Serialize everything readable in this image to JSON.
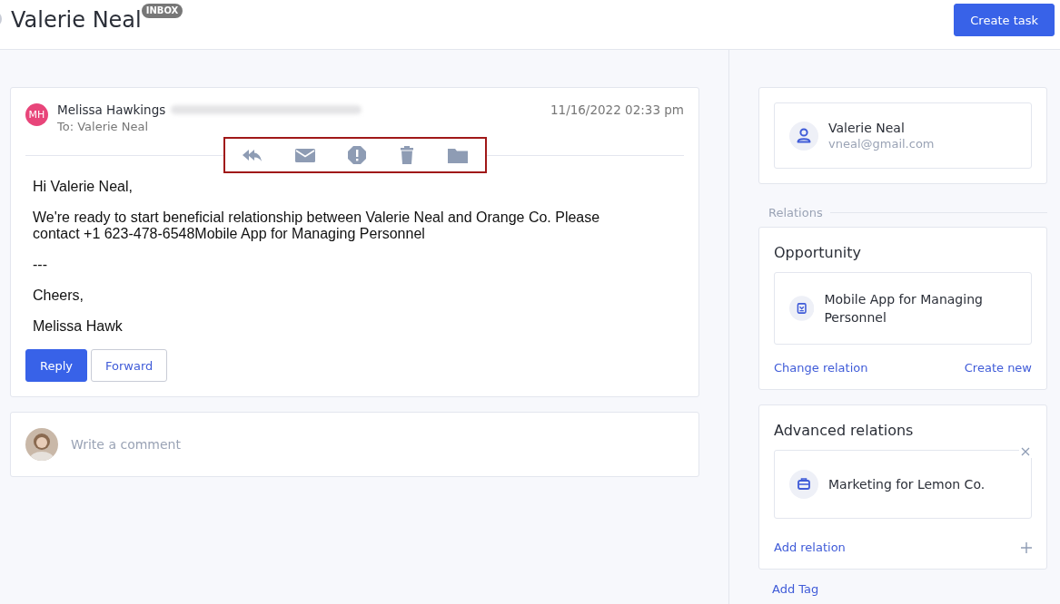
{
  "header": {
    "title": "Valerie Neal",
    "badge": "INBOX",
    "button": "Create task"
  },
  "email": {
    "sender_initials": "MH",
    "sender": "Melissa Hawkings",
    "date": "11/16/2022 02:33 pm",
    "to": "To: Valerie Neal",
    "toolbar": [
      {
        "kind": "reply-all"
      },
      {
        "kind": "mail"
      },
      {
        "kind": "spam"
      },
      {
        "kind": "trash"
      },
      {
        "kind": "folder"
      }
    ],
    "body": [
      "Hi Valerie Neal,",
      "We're ready to start beneficial relationship between Valerie Neal and Orange Co.  Please contact  +1 623-478-6548Mobile App for Managing Personnel",
      "---",
      "Cheers,",
      "Melissa Hawk"
    ],
    "buttons": [
      {
        "label": "Reply",
        "primary": true
      },
      {
        "label": "Forward",
        "primary": false
      }
    ]
  },
  "comment": {
    "placeholder": "Write a comment"
  },
  "contact": {
    "name": "Valerie Neal",
    "email": "vneal@gmail.com"
  },
  "relations_label": "Relations",
  "opportunity": {
    "title": "Opportunity",
    "item": "Mobile App for Managing Personnel",
    "links": [
      "Change relation",
      "Create new"
    ]
  },
  "advanced": {
    "title": "Advanced relations",
    "item": "Marketing for Lemon Co.",
    "add": "Add relation"
  },
  "add_tag": "Add Tag"
}
